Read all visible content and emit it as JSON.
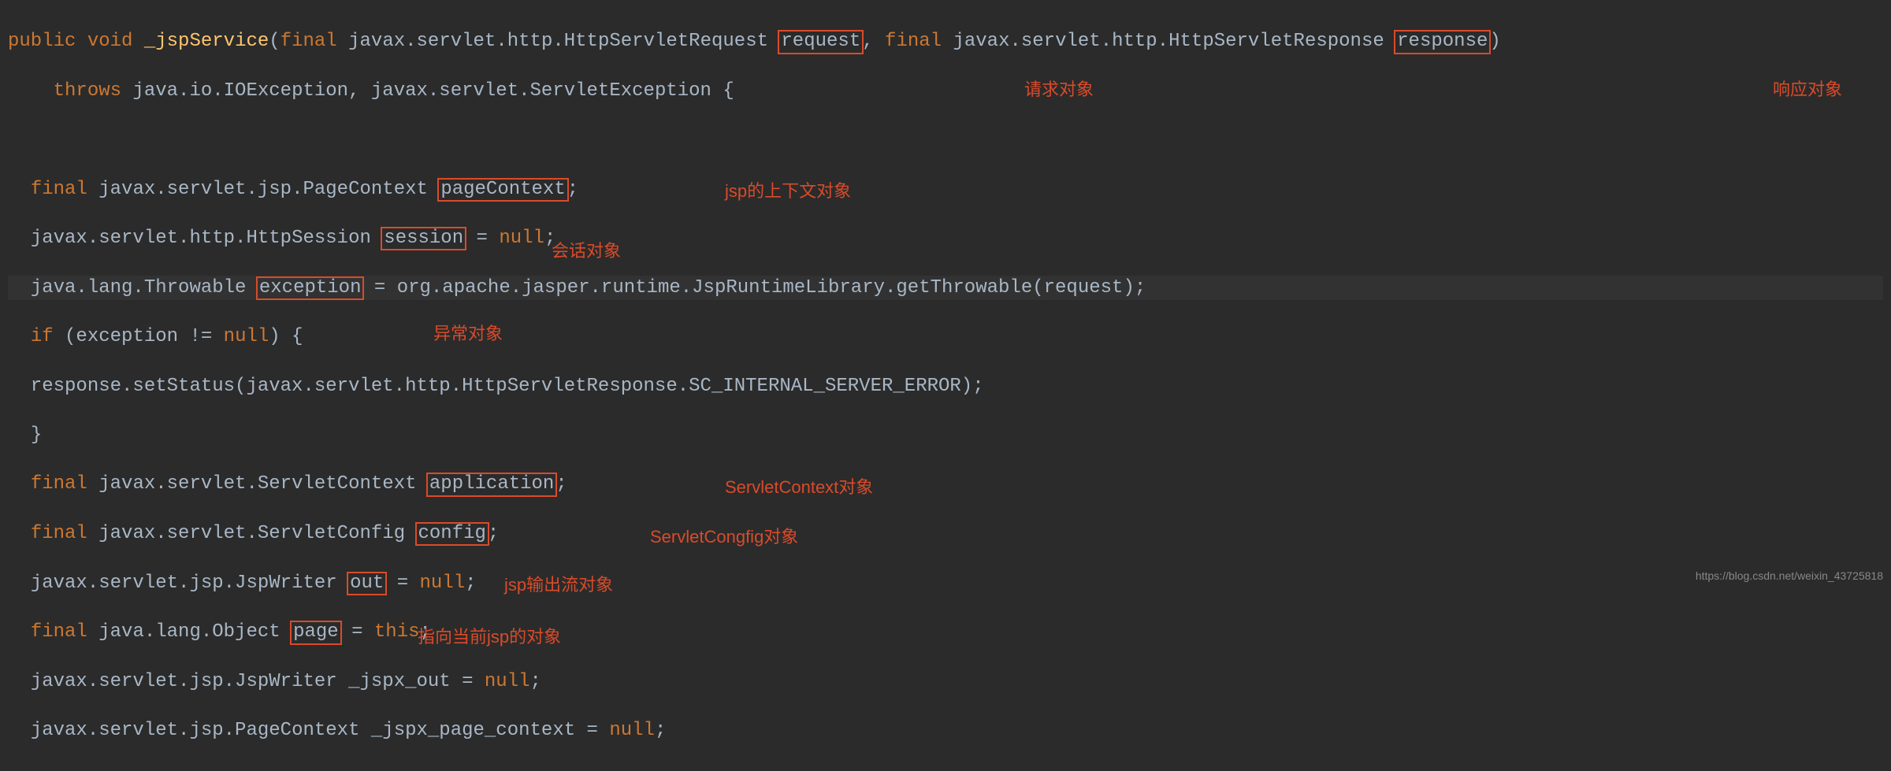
{
  "code": {
    "l1_public": "public",
    "l1_void": "void",
    "l1_fn": "_jspService",
    "l1_open": "(",
    "l1_final1": "final",
    "l1_t1": " javax.servlet.http.HttpServletRequest ",
    "l1_p1": "request",
    "l1_comma": ", ",
    "l1_final2": "final",
    "l1_t2": " javax.servlet.http.HttpServletResponse ",
    "l1_p2": "response",
    "l1_close": ")",
    "l2": "throws",
    "l2b": " java.io.IOException, javax.servlet.ServletException {",
    "l4_final": "final",
    "l4_t": " javax.servlet.jsp.PageContext ",
    "l4_v": "pageContext",
    "l4_semi": ";",
    "l5_t": "javax.servlet.http.HttpSession ",
    "l5_v": "session",
    "l5_rest": " = ",
    "l5_null": "null",
    "l5_semi": ";",
    "l6_t": "java.lang.Throwable ",
    "l6_v": "exception",
    "l6_rest": " = org.apache.jasper.runtime.JspRuntimeLibrary.getThrowable(request);",
    "l7_if": "if",
    "l7_rest": " (exception != ",
    "l7_null": "null",
    "l7_close": ") {",
    "l8": "  response.setStatus(javax.servlet.http.HttpServletResponse.SC_INTERNAL_SERVER_ERROR);",
    "l9": "}",
    "l10_final": "final",
    "l10_t": " javax.servlet.ServletContext ",
    "l10_v": "application",
    "l10_semi": ";",
    "l11_final": "final",
    "l11_t": " javax.servlet.ServletConfig ",
    "l11_v": "config",
    "l11_semi": ";",
    "l12_t": "javax.servlet.jsp.JspWriter ",
    "l12_v": "out",
    "l12_rest": " = ",
    "l12_null": "null",
    "l12_semi": ";",
    "l13_final": "final",
    "l13_t": " java.lang.Object ",
    "l13_v": "page",
    "l13_rest": " = ",
    "l13_this": "this",
    "l13_semi": ";",
    "l14": "javax.servlet.jsp.JspWriter _jspx_out = ",
    "l14_null": "null",
    "l14_semi": ";",
    "l15": "javax.servlet.jsp.PageContext _jspx_page_context = ",
    "l15_null": "null",
    "l15_semi": ";"
  },
  "annotations": {
    "request": "请求对象",
    "response": "响应对象",
    "pageContext": "jsp的上下文对象",
    "session": "会话对象",
    "exception": "异常对象",
    "application": "ServletContext对象",
    "config": "ServletCongfig对象",
    "out": "jsp输出流对象",
    "page": "指向当前jsp的对象"
  },
  "watermark": "https://blog.csdn.net/weixin_43725818"
}
